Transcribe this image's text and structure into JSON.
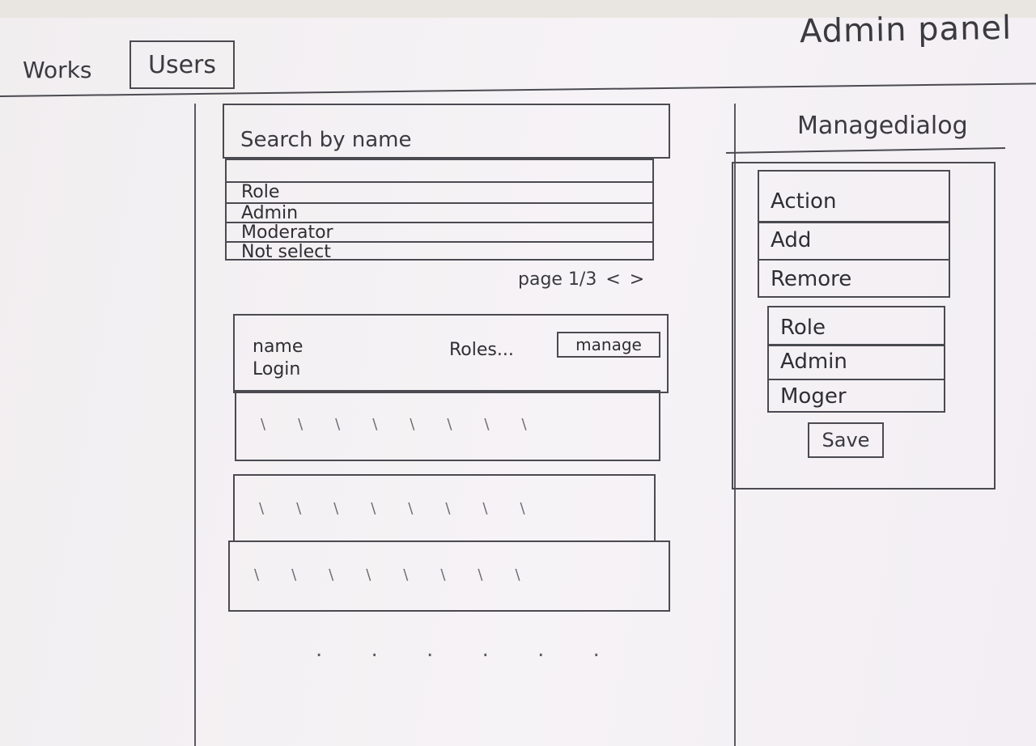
{
  "header": {
    "app_title": "Admin panel",
    "nav": [
      {
        "label": "Works",
        "active": false
      },
      {
        "label": "Users",
        "active": true
      }
    ]
  },
  "main": {
    "search": {
      "placeholder": "Search by name"
    },
    "role_filter": {
      "label": "Role",
      "options": [
        "Admin",
        "Moderator",
        "Not select"
      ]
    },
    "pagination": {
      "text": "page 1/3",
      "prev": "<",
      "next": ">"
    },
    "user_card": {
      "name": "name",
      "login": "Login",
      "roles": "Roles...",
      "manage_label": "manage"
    },
    "more": ". . . . . ."
  },
  "dialog": {
    "title": "Managedialog",
    "action_list": {
      "header": "Action",
      "items": [
        "Add",
        "Remore"
      ]
    },
    "role_list": {
      "header": "Role",
      "items": [
        "Admin",
        "Moger"
      ]
    },
    "save_label": "Save"
  }
}
